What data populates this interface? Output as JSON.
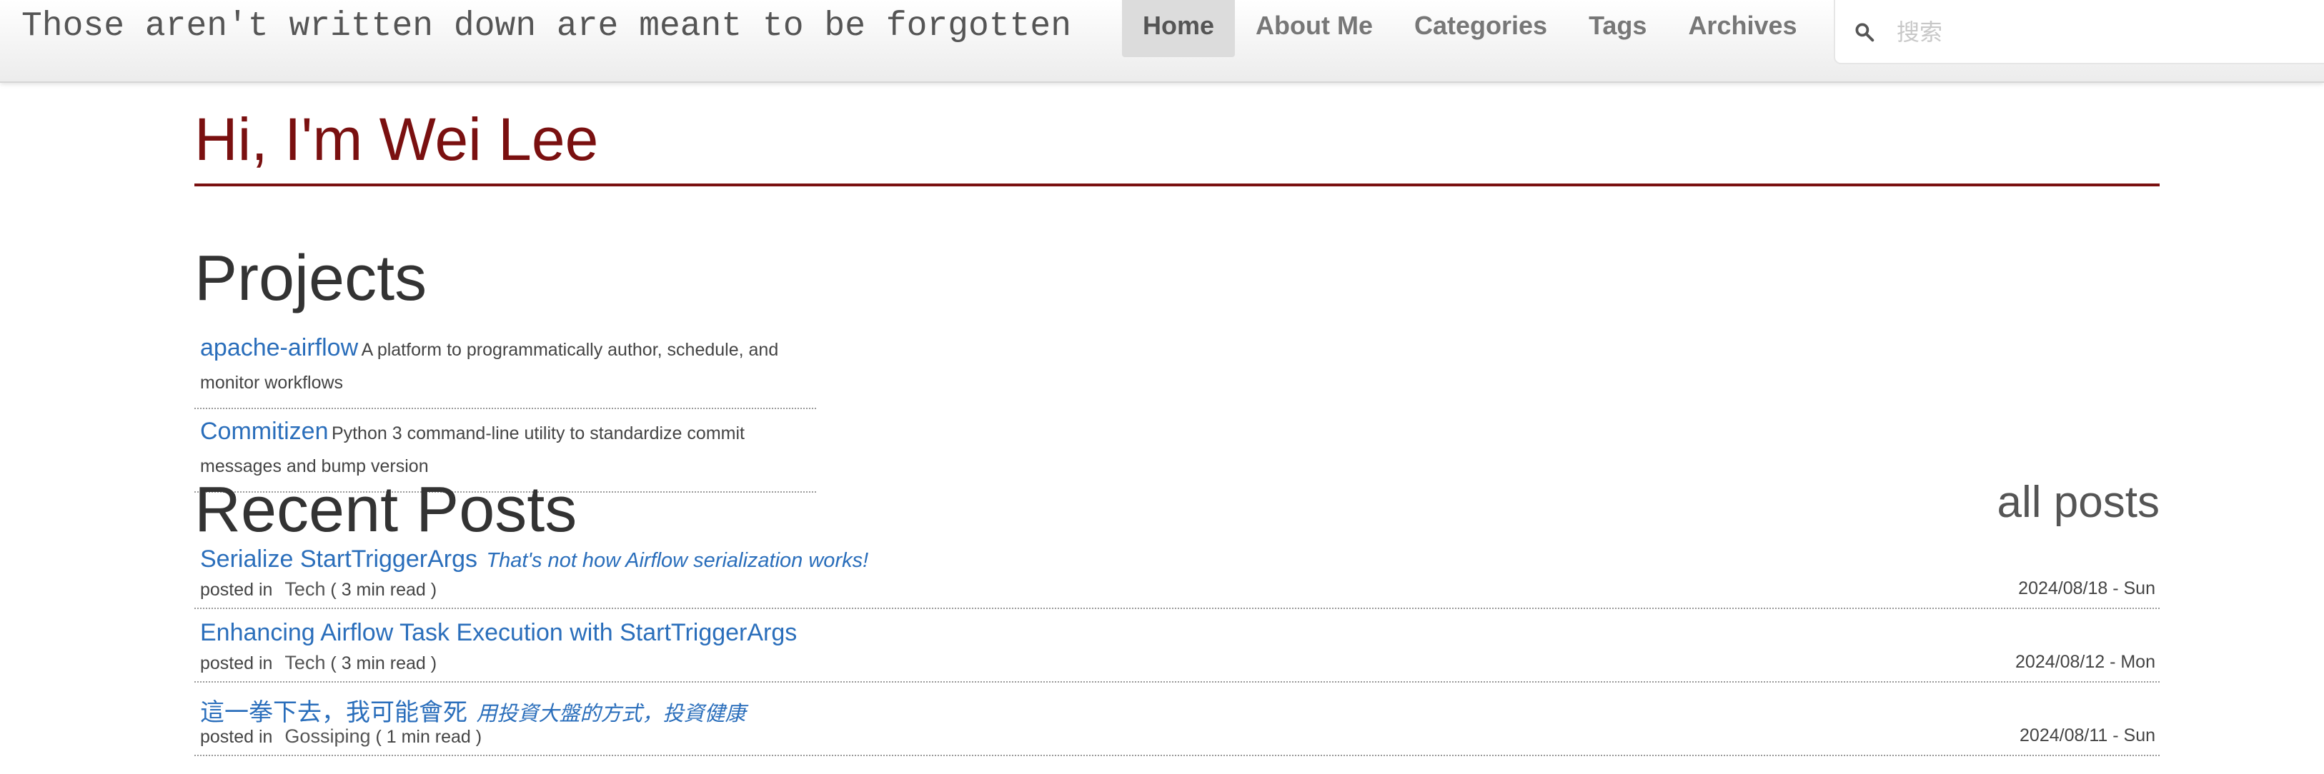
{
  "header": {
    "site_title": "Those aren't written down are meant to be forgotten",
    "nav": [
      {
        "label": "Home",
        "active": true
      },
      {
        "label": "About Me"
      },
      {
        "label": "Categories"
      },
      {
        "label": "Tags"
      },
      {
        "label": "Archives"
      }
    ],
    "search": {
      "placeholder": "搜索",
      "value": "",
      "icon": "search-icon"
    }
  },
  "main": {
    "greeting": "Hi, I'm Wei Lee",
    "projects_heading": "Projects",
    "projects": [
      {
        "name": "apache-airflow",
        "description": "A platform to programmatically author, schedule, and monitor workflows"
      },
      {
        "name": "Commitizen",
        "description": "Python 3 command-line utility to standardize commit messages and bump version"
      }
    ],
    "recent_heading": "Recent Posts",
    "all_posts_label": "all posts",
    "posts": [
      {
        "title": "Serialize StartTriggerArgs",
        "subtitle": "That's not how Airflow serialization works!",
        "posted_in": "posted in",
        "category": "Tech",
        "read_time": "( 3 min read )",
        "date": "2024/08/18 - Sun"
      },
      {
        "title": "Enhancing Airflow Task Execution with StartTriggerArgs",
        "subtitle": "",
        "posted_in": "posted in",
        "category": "Tech",
        "read_time": "( 3 min read )",
        "date": "2024/08/12 - Mon"
      },
      {
        "title": "這一拳下去，我可能會死",
        "subtitle": "用投資大盤的方式，投資健康",
        "posted_in": "posted in",
        "category": "Gossiping",
        "read_time": "( 1 min read )",
        "date": "2024/08/11 - Sun"
      }
    ]
  },
  "colors": {
    "accent": "#7a1010",
    "link": "#2a6ebb"
  }
}
